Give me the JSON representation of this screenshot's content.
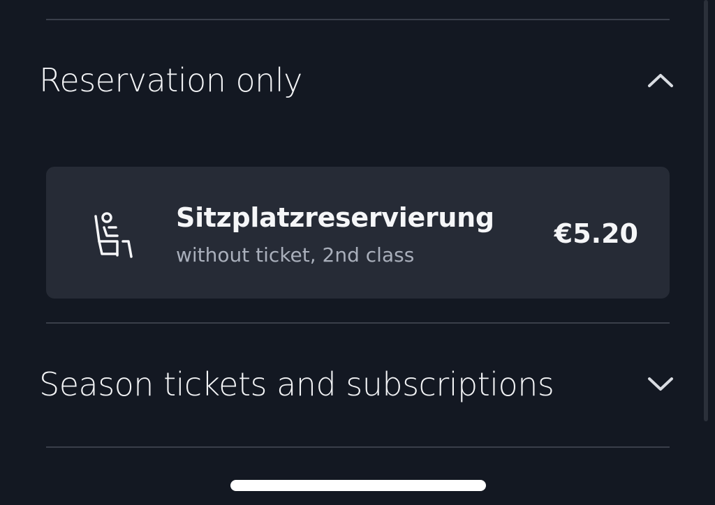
{
  "sections": [
    {
      "title": "Reservation only",
      "expanded": true,
      "chevron_icon": "chevron-up-icon",
      "items": [
        {
          "icon": "seat-reservation-icon",
          "title": "Sitzplatzreservierung",
          "subtitle": "without ticket, 2nd class",
          "price": "€5.20"
        }
      ]
    },
    {
      "title": "Season tickets and subscriptions",
      "expanded": false,
      "chevron_icon": "chevron-down-icon"
    }
  ],
  "colors": {
    "background": "#131822",
    "card": "#262b36",
    "divider": "#3a3f4a",
    "text_primary": "#f3f4f6",
    "text_secondary": "#a9afbb"
  }
}
